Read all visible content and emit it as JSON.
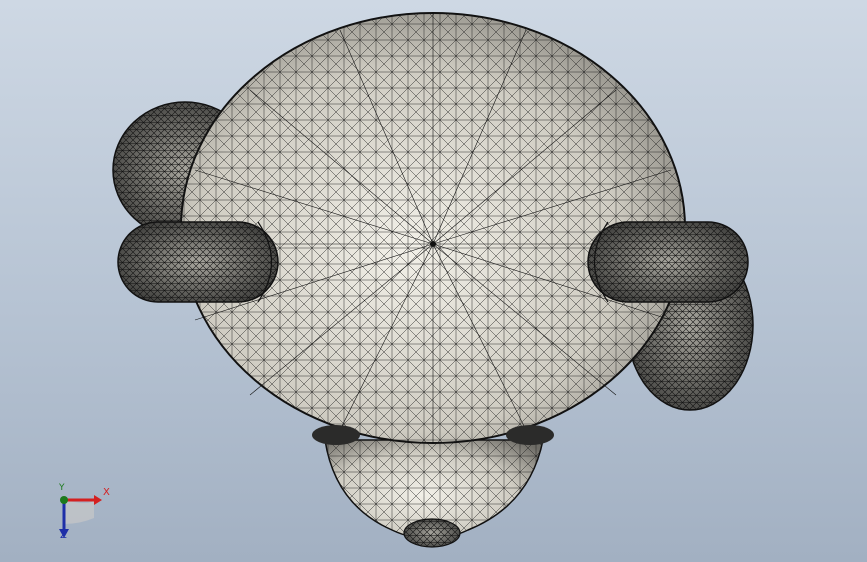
{
  "viewport": {
    "background_top": "#ced8e4",
    "background_bottom": "#a2b0c2",
    "mesh_fill": "#dcdad2",
    "mesh_line": "#1a1a1a"
  },
  "triad": {
    "x_label": "X",
    "y_label": "Y",
    "z_label": "Z",
    "x_color": "#d42020",
    "y_color": "#1d7a1d",
    "z_color": "#1e2fa8"
  }
}
